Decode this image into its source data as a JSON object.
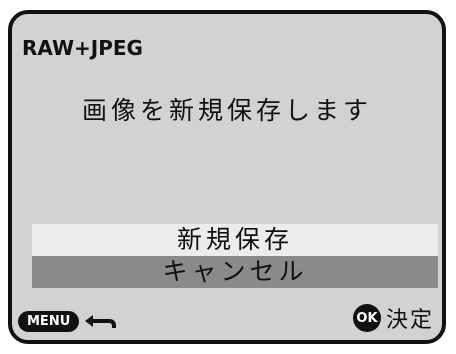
{
  "screen": {
    "title": "RAW+JPEG",
    "message": "画像を新規保存します",
    "options": [
      {
        "label": "新規保存",
        "selected": false
      },
      {
        "label": "キャンセル",
        "selected": true
      }
    ],
    "footer": {
      "menu_label": "MENU",
      "ok_label": "OK",
      "ok_action": "決定",
      "back_icon": "back-arrow-icon"
    },
    "colors": {
      "background": "#d2d2d2",
      "option_default": "#ececec",
      "option_selected": "#8a8a8a"
    }
  }
}
